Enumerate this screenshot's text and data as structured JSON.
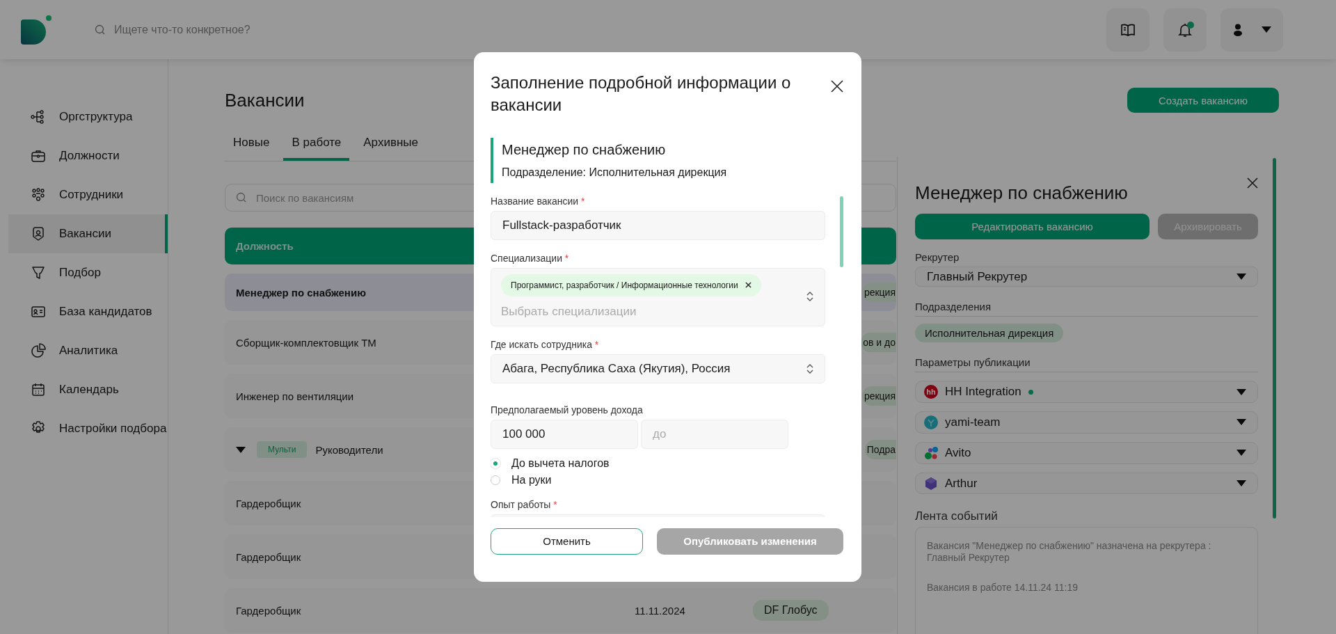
{
  "header": {
    "search_placeholder": "Ищете что-то конкретное?",
    "notification_unread": true
  },
  "sidebar": {
    "items": [
      {
        "label": "Оргструктура",
        "selected": false
      },
      {
        "label": "Должности",
        "selected": false
      },
      {
        "label": "Сотрудники",
        "selected": false
      },
      {
        "label": "Вакансии",
        "selected": true
      },
      {
        "label": "Подбор",
        "selected": false
      },
      {
        "label": "База кандидатов",
        "selected": false
      },
      {
        "label": "Аналитика",
        "selected": false
      },
      {
        "label": "Календарь",
        "selected": false
      },
      {
        "label": "Настройки подбора",
        "selected": false
      }
    ]
  },
  "page": {
    "title": "Вакансии",
    "create_button": "Создать вакансию",
    "tabs": [
      {
        "label": "Новые",
        "selected": false
      },
      {
        "label": "В работе",
        "selected": true
      },
      {
        "label": "Архивные",
        "selected": false
      }
    ],
    "search_placeholder": "Поиск по вакансиям",
    "table": {
      "columns": [
        "Должность"
      ],
      "rows": [
        {
          "kind": "vacancy",
          "title": "Менеджер по снабжению",
          "selected": true,
          "tag": "рекция"
        },
        {
          "kind": "vacancy",
          "title": "Сборщик-комплектовщик ТМ",
          "selected": false,
          "tag": "ов и до"
        },
        {
          "kind": "vacancy",
          "title": "Инженер по вентиляции",
          "selected": false,
          "tag": "рекция"
        },
        {
          "kind": "group",
          "title": "Руководители",
          "badge": "Мульти",
          "expanded": true,
          "selected": false,
          "tag": "Подра"
        },
        {
          "kind": "vacancy",
          "title": "Гардеробщик",
          "selected": false
        },
        {
          "kind": "vacancy",
          "title": "Гардеробщик",
          "selected": false
        },
        {
          "kind": "vacancy",
          "title": "Гардеробщик",
          "selected": false,
          "date": "11.11.2024",
          "company": "DF Глобус"
        }
      ]
    }
  },
  "details_panel": {
    "title": "Менеджер по снабжению",
    "edit_button": "Редактировать вакансию",
    "archive_button": "Архивировать",
    "recruiter_label": "Рекрутер",
    "recruiter": "Главный Рекрутер",
    "departments_label": "Подразделения",
    "departments": [
      "Исполнительная дирекция"
    ],
    "publishing_label": "Параметры публикации",
    "integrations": [
      {
        "kind": "hh",
        "name": "HH Integration",
        "logo_text": "hh",
        "connected": true
      },
      {
        "kind": "yami",
        "name": "yami-team",
        "connected": false
      },
      {
        "kind": "avito",
        "name": "Avito",
        "connected": false
      },
      {
        "kind": "arthur",
        "name": "Arthur",
        "connected": false
      }
    ],
    "feed_label": "Лента событий",
    "feed": [
      "Вакансия \"Менеджер по снабжению\" назначена на рекрутера : Главный Рекрутер",
      "Вакансия в работе 14.11.24 11:19"
    ]
  },
  "modal": {
    "title": "Заполнение подробной информации о вакансии",
    "vacancy": "Менеджер по снабжению",
    "department": "Подразделение: Исполнительная дирекция",
    "name_field": {
      "label": "Название вакансии",
      "required_mark": "*",
      "value": "Fullstack-разработчик"
    },
    "specializations_field": {
      "label": "Специализации",
      "required_mark": "*",
      "chips": [
        "Программист, разработчик / Информационные технологии"
      ],
      "placeholder": "Выбрать специализации"
    },
    "location_field": {
      "label": "Где искать сотрудника",
      "required_mark": "*",
      "value": "Абага, Республика Саха (Якутия), Россия"
    },
    "income": {
      "label": "Предполагаемый уровень дохода",
      "from_value": "100 000",
      "to_placeholder": "до",
      "options": [
        {
          "label": "До вычета налогов",
          "selected": true
        },
        {
          "label": "На руки",
          "selected": false
        }
      ]
    },
    "experience_field": {
      "label": "Опыт работы",
      "required_mark": "*"
    },
    "cancel_button": "Отменить",
    "publish_button": "Опубликовать изменения",
    "publish_disabled": true
  }
}
